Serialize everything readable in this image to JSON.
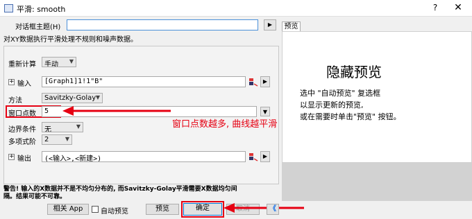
{
  "window": {
    "title": "平滑: smooth",
    "help": "?",
    "close": "✕"
  },
  "dialog_theme": {
    "label": "对话框主题(H)",
    "value": "",
    "arrow": "▶"
  },
  "description": "对XY数据执行平滑处理不规则和噪声数据。",
  "form": {
    "recalc": {
      "label": "重新计算",
      "value": "手动"
    },
    "input": {
      "label": "输入",
      "value": "[Graph1]1!1\"B\""
    },
    "method": {
      "label": "方法",
      "value": "Savitzky-Golay"
    },
    "points": {
      "label": "窗口点数",
      "value": "5"
    },
    "boundary": {
      "label": "边界条件",
      "value": "无"
    },
    "poly_order": {
      "label": "多项式阶",
      "value": "2"
    },
    "output": {
      "label": "输出",
      "value": "(<输入>,<新建>)"
    }
  },
  "warning": {
    "line1": "警告! 输入的X数据并不是不均匀分布的, 而Savitzky-Golay平滑需要X数据均匀间",
    "line2": "隔。结果可能不可靠。"
  },
  "preview": {
    "tab": "预览",
    "title": "隐藏预览",
    "desc1": "选中 \"自动预览\" 复选框",
    "desc2": "以显示更新的预览,",
    "desc3": "或在需要时单击\"预览\" 按钮。"
  },
  "annotation": "窗口点数越多, 曲线越平滑",
  "buttons": {
    "related_app": "相关 App",
    "auto_preview": "自动预览",
    "preview": "预览",
    "ok": "确定",
    "cancel": "取消",
    "collapse": "《"
  },
  "colors": {
    "annotation_red": "#e60012",
    "accent_blue": "#1a73e8"
  }
}
